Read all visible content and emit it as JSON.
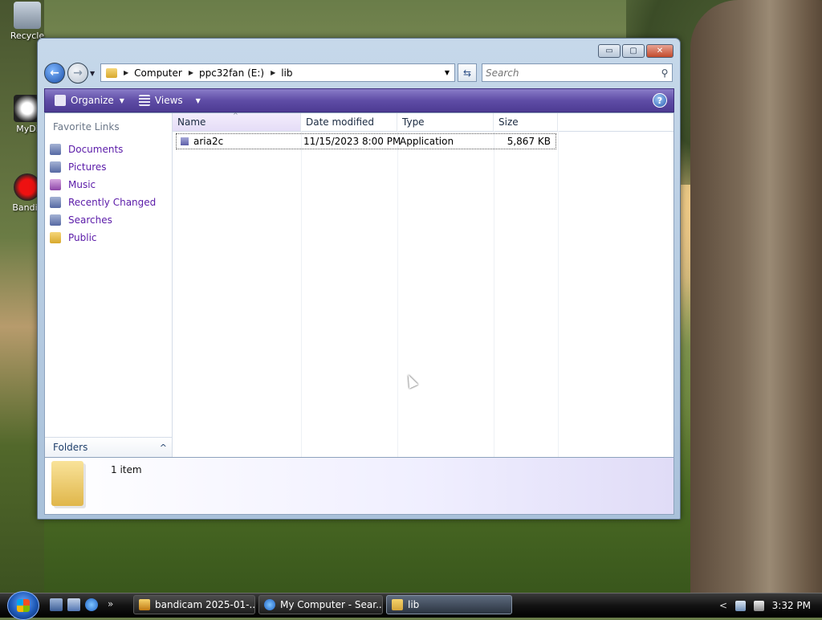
{
  "desktop": {
    "icons": [
      {
        "label": "Recycle"
      },
      {
        "label": "MyDi"
      },
      {
        "label": "Bandic"
      }
    ]
  },
  "window": {
    "controls": {
      "minimize": "▭",
      "maximize": "▢",
      "close": "✕"
    },
    "address": {
      "crumbs": [
        "Computer",
        "ppc32fan (E:)",
        "lib"
      ]
    },
    "search": {
      "placeholder": "Search"
    },
    "toolbar": {
      "organize": "Organize",
      "views": "Views",
      "help": "?"
    },
    "favorites": {
      "title": "Favorite Links",
      "items": [
        "Documents",
        "Pictures",
        "Music",
        "Recently Changed",
        "Searches",
        "Public"
      ]
    },
    "folders_label": "Folders",
    "columns": [
      "Name",
      "Date modified",
      "Type",
      "Size"
    ],
    "files": [
      {
        "name": "aria2c",
        "date_modified": "11/15/2023 8:00 PM",
        "type": "Application",
        "size": "5,867 KB"
      }
    ],
    "details": {
      "item_count": "1 item"
    }
  },
  "taskbar": {
    "quick_more": "»",
    "tasks": [
      {
        "label": "bandicam 2025-01-..."
      },
      {
        "label": "My Computer - Sear..."
      },
      {
        "label": "lib"
      }
    ],
    "tray": {
      "arrow": "<",
      "clock": "3:32 PM"
    }
  },
  "colors": {
    "toolbar": "#5f4da6",
    "link": "#5a1aa8",
    "taskbar": "#131313"
  }
}
